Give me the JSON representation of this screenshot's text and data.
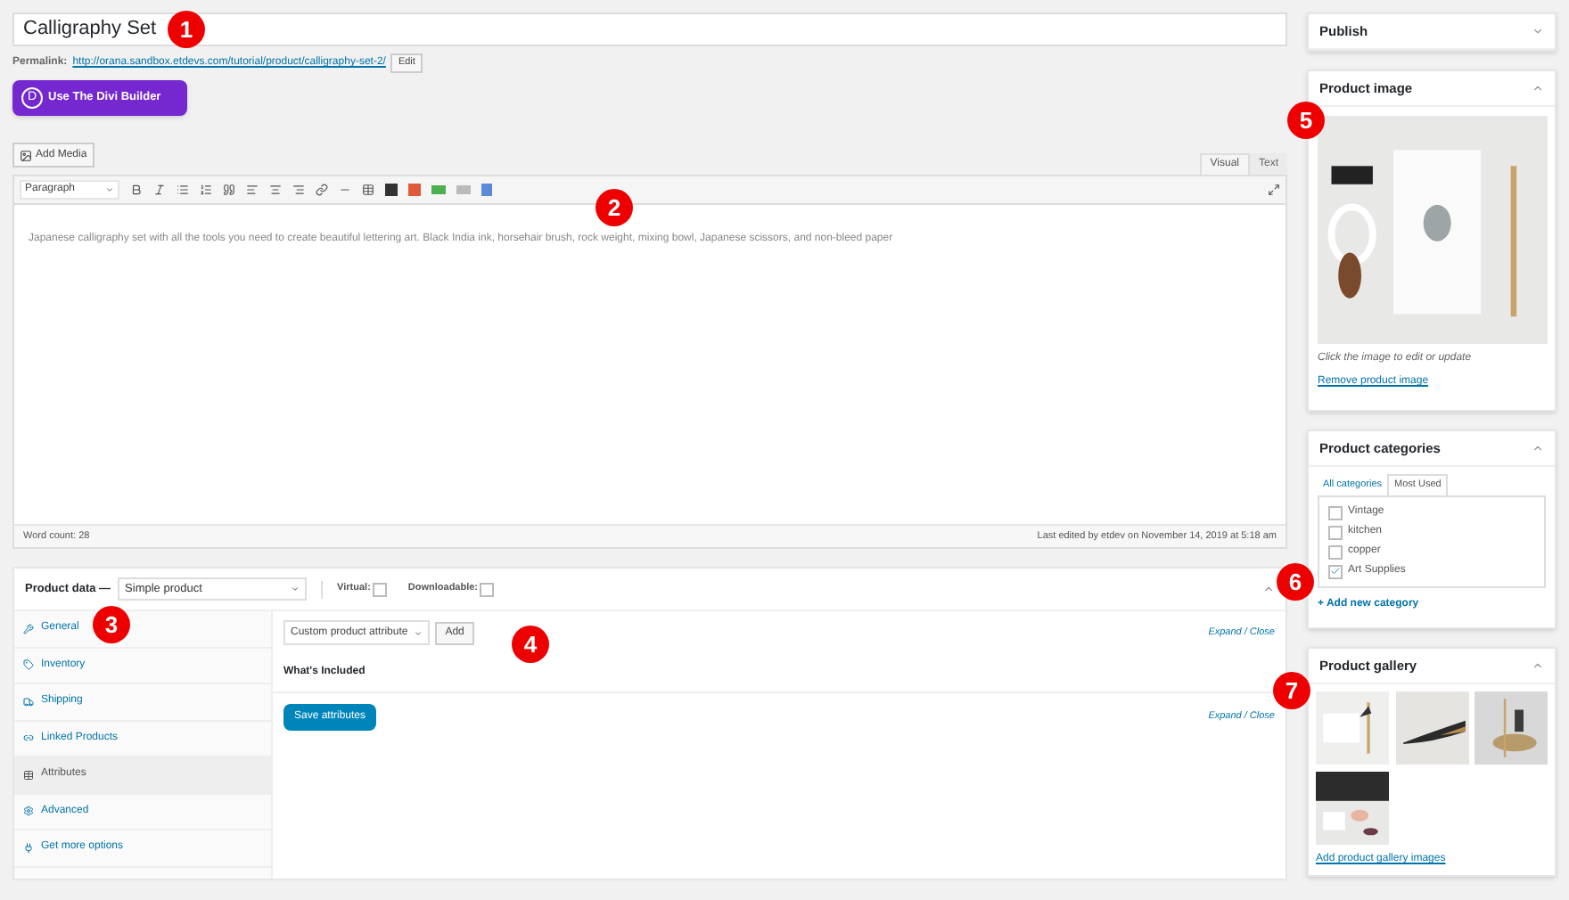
{
  "title": "Calligraphy Set",
  "permalink": {
    "label": "Permalink:",
    "url": "http://orana.sandbox.etdevs.com/tutorial/product/calligraphy-set-2/",
    "button": "Edit"
  },
  "divi_button": {
    "icon": "D",
    "label": "Use The Divi Builder"
  },
  "editor": {
    "add_media": "Add Media",
    "tabs": [
      {
        "label": "Visual",
        "selected": true
      },
      {
        "label": "Text",
        "selected": false
      }
    ],
    "format": "Paragraph",
    "content": "Japanese calligraphy set with all the tools you need to create beautiful lettering art. Black India ink, horsehair brush, rock weight, mixing bowl, Japanese scissors, and non-bleed paper",
    "word_count": "Word count: 28",
    "last_edited": "Last edited by etdev on November 14, 2019 at 5:18 am"
  },
  "product_data": {
    "label": "Product data —",
    "type": "Simple product",
    "options": [
      {
        "label": "Virtual:",
        "checked": false
      },
      {
        "label": "Downloadable:",
        "checked": false
      }
    ],
    "tabs": [
      {
        "label": "General",
        "selected": false
      },
      {
        "label": "Inventory",
        "selected": false
      },
      {
        "label": "Shipping",
        "selected": false
      },
      {
        "label": "Linked Products",
        "selected": false
      },
      {
        "label": "Attributes",
        "selected": true
      },
      {
        "label": "Advanced",
        "selected": false
      },
      {
        "label": "Get more options",
        "selected": false
      }
    ],
    "attribute_select": "Custom product attribute",
    "add_button": "Add",
    "expand_top": "Expand / Close",
    "attribute": "What's Included",
    "save_button": "Save attributes",
    "expand_bottom": "Expand / Close"
  },
  "sidebar": {
    "publish": {
      "title": "Publish"
    },
    "product_image": {
      "title": "Product image",
      "hint": "Click the image to edit or update",
      "remove": "Remove product image"
    },
    "categories": {
      "title": "Product categories",
      "tabs": [
        {
          "label": "All categories",
          "selected": false
        },
        {
          "label": "Most Used",
          "selected": true
        }
      ],
      "items": [
        {
          "label": "Vintage",
          "checked": false
        },
        {
          "label": "kitchen",
          "checked": false
        },
        {
          "label": "copper",
          "checked": false
        },
        {
          "label": "Art Supplies",
          "checked": true
        }
      ],
      "add": "+ Add new category"
    },
    "gallery": {
      "title": "Product gallery",
      "add": "Add product gallery images"
    }
  },
  "markers": [
    {
      "label": "1"
    },
    {
      "label": "2"
    },
    {
      "label": "3"
    },
    {
      "label": "4"
    },
    {
      "label": "5"
    },
    {
      "label": "6"
    },
    {
      "label": "7"
    }
  ]
}
